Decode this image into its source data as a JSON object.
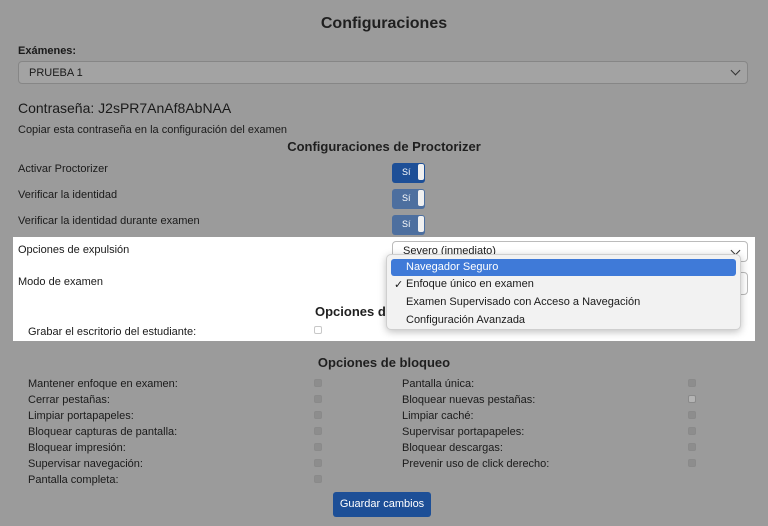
{
  "title": "Configuraciones",
  "exams": {
    "label": "Exámenes:",
    "selected": "PRUEBA 1"
  },
  "password": {
    "label": "Contraseña: J2sPR7AnAf8AbNAA",
    "hint": "Copiar esta contraseña en la configuración del examen"
  },
  "proctorizer": {
    "heading": "Configuraciones de Proctorizer",
    "toggles": [
      {
        "label": "Activar Proctorizer",
        "value": "Sí"
      },
      {
        "label": "Verificar la identidad",
        "value": "Sí"
      },
      {
        "label": "Verificar la identidad durante examen",
        "value": "Sí"
      }
    ]
  },
  "expulsion": {
    "label": "Opciones de expulsión",
    "selected": "Severo (inmediato)"
  },
  "exam_mode": {
    "label": "Modo de examen",
    "options": [
      {
        "label": "Navegador Seguro",
        "highlighted": true,
        "checked": false
      },
      {
        "label": "Enfoque único en examen",
        "highlighted": false,
        "checked": true
      },
      {
        "label": "Examen Supervisado con Acceso a Navegación",
        "highlighted": false,
        "checked": false
      },
      {
        "label": "Configuración Avanzada",
        "highlighted": false,
        "checked": false
      }
    ],
    "check_glyph": "✓"
  },
  "recording": {
    "heading_partial": "Opciones de",
    "desktop_label": "Grabar el escritorio del estudiante:"
  },
  "lock": {
    "heading": "Opciones de bloqueo",
    "left": [
      {
        "label": "Mantener enfoque en examen:",
        "checked": true
      },
      {
        "label": "Cerrar pestañas:",
        "checked": true
      },
      {
        "label": "Limpiar portapapeles:",
        "checked": true
      },
      {
        "label": "Bloquear capturas de pantalla:",
        "checked": true
      },
      {
        "label": "Bloquear impresión:",
        "checked": true
      },
      {
        "label": "Supervisar navegación:",
        "checked": true
      },
      {
        "label": "Pantalla completa:",
        "checked": true
      }
    ],
    "right": [
      {
        "label": "Pantalla única:",
        "checked": true
      },
      {
        "label": "Bloquear nuevas pestañas:",
        "checked": false
      },
      {
        "label": "Limpiar caché:",
        "checked": true
      },
      {
        "label": "Supervisar portapapeles:",
        "checked": true
      },
      {
        "label": "Bloquear descargas:",
        "checked": true
      },
      {
        "label": "Prevenir uso de click derecho:",
        "checked": true
      }
    ]
  },
  "save_label": "Guardar cambios",
  "icons": {
    "chevron": "chevron-down-icon",
    "check": "checkmark-icon"
  }
}
